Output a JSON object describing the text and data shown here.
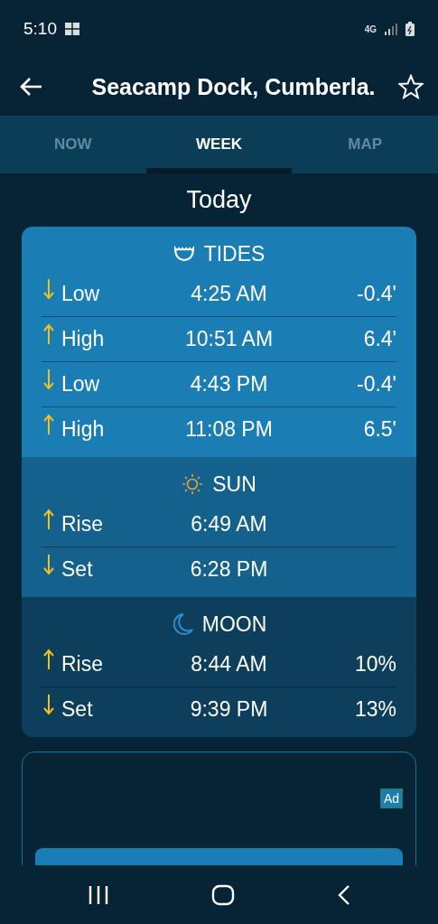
{
  "status_bar": {
    "time": "5:10",
    "network": "4G"
  },
  "app_bar": {
    "title": "Seacamp Dock, Cumberla.",
    "favorite": false
  },
  "tabs": [
    {
      "label": "NOW",
      "selected": false
    },
    {
      "label": "WEEK",
      "selected": true
    },
    {
      "label": "MAP",
      "selected": false
    }
  ],
  "day_title": "Today",
  "sections": [
    {
      "kind": "tides",
      "title": "TIDES",
      "rows": [
        {
          "kind": "down",
          "label": "Low",
          "time": "4:25 AM",
          "value": "-0.4'"
        },
        {
          "kind": "up",
          "label": "High",
          "time": "10:51 AM",
          "value": "6.4'"
        },
        {
          "kind": "down",
          "label": "Low",
          "time": "4:43 PM",
          "value": "-0.4'"
        },
        {
          "kind": "up",
          "label": "High",
          "time": "11:08 PM",
          "value": "6.5'"
        }
      ]
    },
    {
      "kind": "sun",
      "title": "SUN",
      "rows": [
        {
          "kind": "up",
          "label": "Rise",
          "time": "6:49 AM"
        },
        {
          "kind": "down",
          "label": "Set",
          "time": "6:28 PM"
        }
      ]
    },
    {
      "kind": "moon",
      "title": "MOON",
      "rows": [
        {
          "kind": "up",
          "label": "Rise",
          "time": "8:44 AM",
          "value": "10%"
        },
        {
          "kind": "down",
          "label": "Set",
          "time": "9:39 PM",
          "value": "13%"
        }
      ]
    }
  ],
  "ad": {
    "badge": "Ad"
  }
}
